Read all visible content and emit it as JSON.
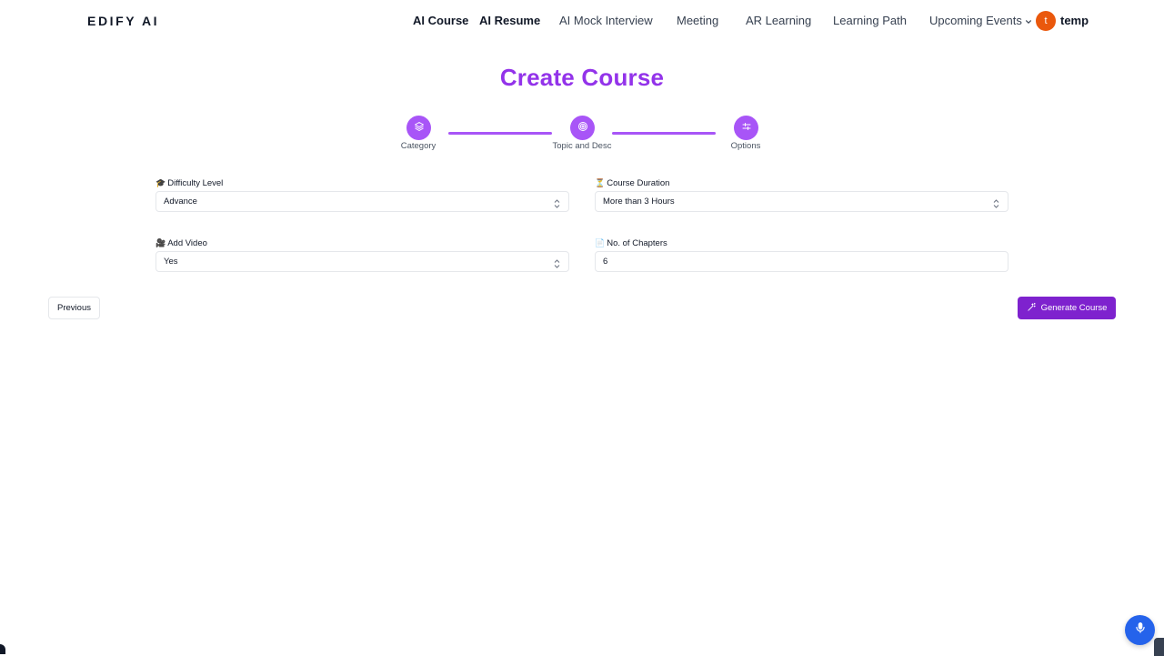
{
  "brand": "EDIFY AI",
  "nav": {
    "items": [
      {
        "label": "AI Course"
      },
      {
        "label": "AI Resume"
      },
      {
        "label": "AI Mock Interview"
      },
      {
        "label": "Meeting"
      },
      {
        "label": "AR Learning"
      },
      {
        "label": "Learning Path"
      },
      {
        "label": "Upcoming Events"
      }
    ]
  },
  "user": {
    "initial": "t",
    "name": "temp"
  },
  "page": {
    "title": "Create Course"
  },
  "steps": [
    {
      "label": "Category",
      "icon": "layers-icon"
    },
    {
      "label": "Topic and Desc",
      "icon": "target-icon"
    },
    {
      "label": "Options",
      "icon": "sliders-icon"
    }
  ],
  "form": {
    "difficulty": {
      "label": "Difficulty Level",
      "emoji": "🎓",
      "value": "Advance"
    },
    "duration": {
      "label": "Course Duration",
      "emoji": "⏳",
      "value": "More than 3 Hours"
    },
    "video": {
      "label": "Add Video",
      "emoji": "🎥",
      "value": "Yes"
    },
    "chapters": {
      "label": "No. of Chapters",
      "emoji": "📄",
      "value": "6"
    }
  },
  "actions": {
    "previous": "Previous",
    "generate": "Generate Course"
  },
  "colors": {
    "accent": "#a855f7",
    "title": "#9333ea",
    "primary_button": "#7e22ce",
    "mic": "#2563eb",
    "avatar": "#ea580c"
  }
}
